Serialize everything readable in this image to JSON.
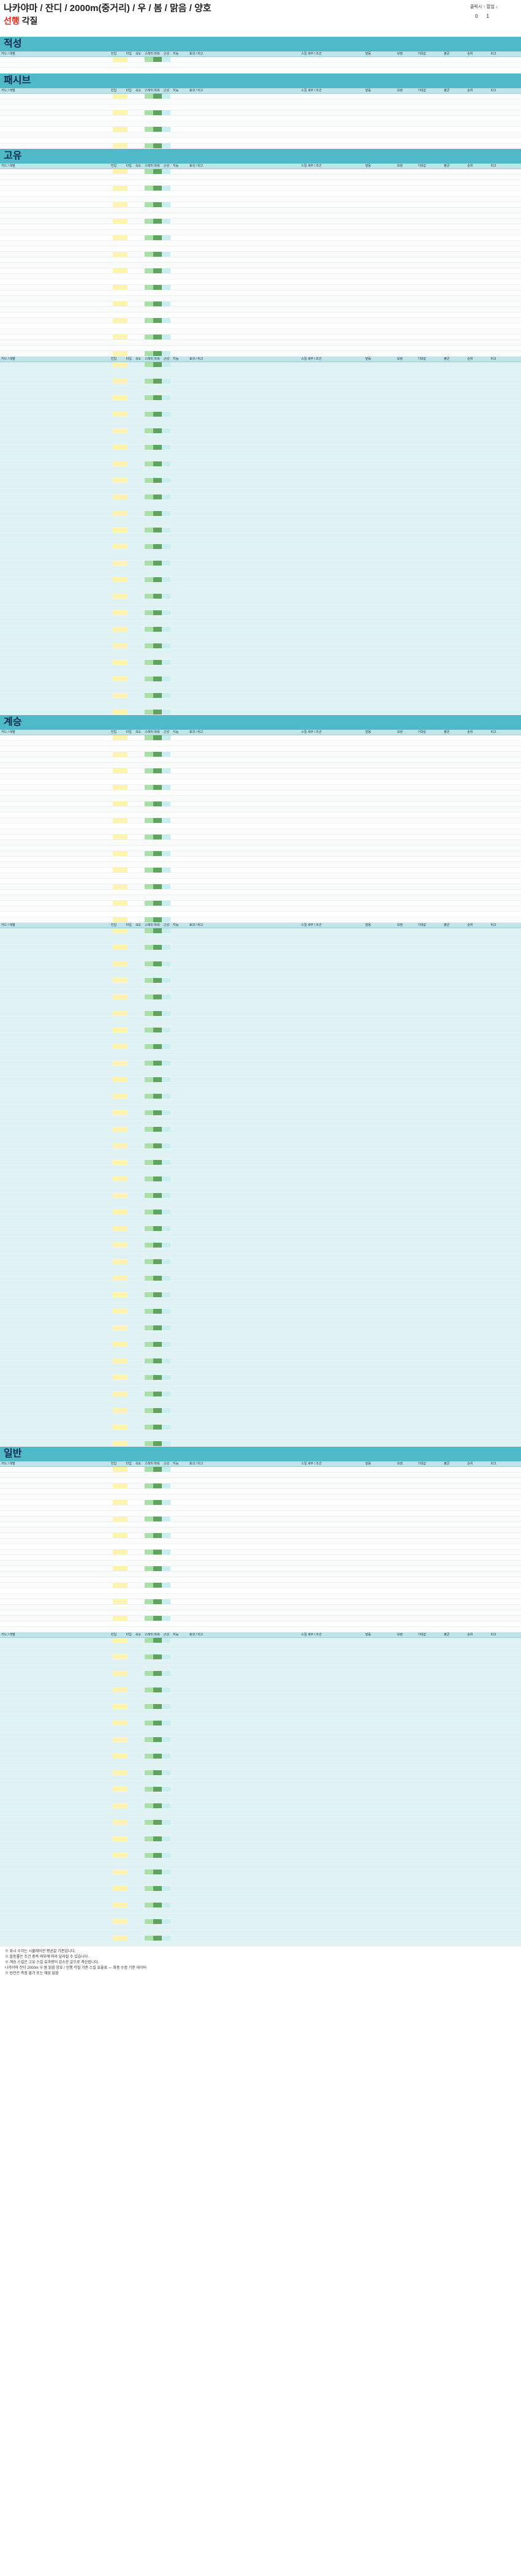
{
  "header": {
    "title": "나카야마 / 잔디 / 2000m(중거리) / 우 / 봄 / 맑음 / 양호",
    "subtitle_highlight": "선행",
    "subtitle_rest": " 각질",
    "note": "클릭시 ↑ 팝업 ↓",
    "marker1": "0",
    "marker2": "1"
  },
  "columns": [
    "카드 / 레벨",
    "",
    "진입",
    "타입",
    "속도",
    "스태미나",
    "파워",
    "근성",
    "지능",
    "효과 / 비고",
    "스킬 세부 / 조건",
    "발동",
    "보정",
    "기대값",
    "평균",
    "순위",
    "비고"
  ],
  "sections": [
    {
      "title": "적성",
      "rows": 3,
      "band": false
    },
    {
      "title": "패시브",
      "rows": 10,
      "band": false
    },
    {
      "title": "고유",
      "rows": 34,
      "band": false
    },
    {
      "title": "",
      "rows": 64,
      "band": true
    },
    {
      "title": "계승",
      "rows": 34,
      "band": false
    },
    {
      "title": "",
      "rows": 94,
      "band": true
    },
    {
      "title": "일반",
      "rows": 30,
      "band": false
    },
    {
      "title": "",
      "rows": 56,
      "band": true
    }
  ],
  "footer": [
    "※ 표시 수치는 시뮬레이션 평균값 기준입니다.",
    "※ 발동률은 조건 충족 여부에 따라 달라질 수 있습니다.",
    "※ 계승 스킬은 고유 스킬 효과량이 감소한 값으로 계산됩니다.",
    "나카야마 잔디 2000m 우 봄 맑음 양호 / 선행 각질 기준 스킬 효율표 — 최종 수정 기준 데이터",
    "※ 빈칸은 측정 불가 또는 해당 없음"
  ]
}
